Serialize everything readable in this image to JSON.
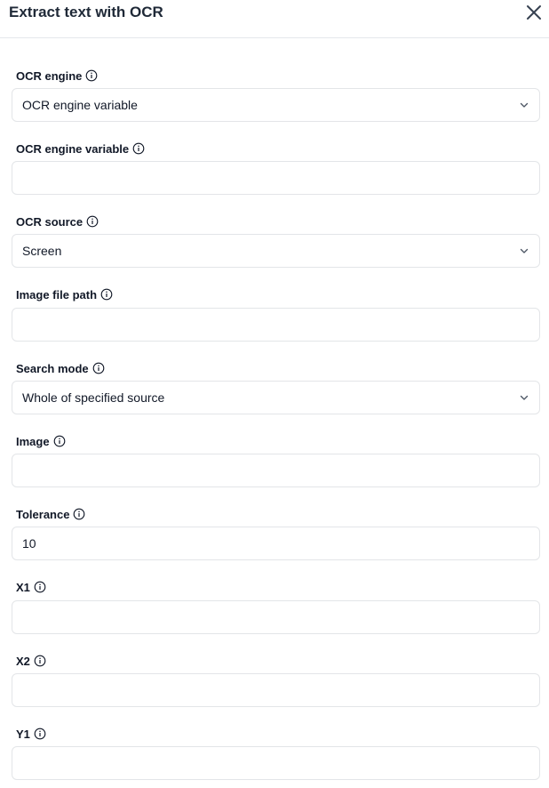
{
  "panel": {
    "title": "Extract text with OCR"
  },
  "fields": {
    "ocr_engine": {
      "label": "OCR engine",
      "value": "OCR engine variable"
    },
    "ocr_engine_variable": {
      "label": "OCR engine variable",
      "value": ""
    },
    "ocr_source": {
      "label": "OCR source",
      "value": "Screen"
    },
    "image_file_path": {
      "label": "Image file path",
      "value": ""
    },
    "search_mode": {
      "label": "Search mode",
      "value": "Whole of specified source"
    },
    "image": {
      "label": "Image",
      "value": ""
    },
    "tolerance": {
      "label": "Tolerance",
      "value": "10"
    },
    "x1": {
      "label": "X1",
      "value": ""
    },
    "x2": {
      "label": "X2",
      "value": ""
    },
    "y1": {
      "label": "Y1",
      "value": ""
    }
  },
  "icons": {
    "close": "close-icon",
    "info": "info-icon",
    "dropdown": "chevron-down-icon"
  }
}
